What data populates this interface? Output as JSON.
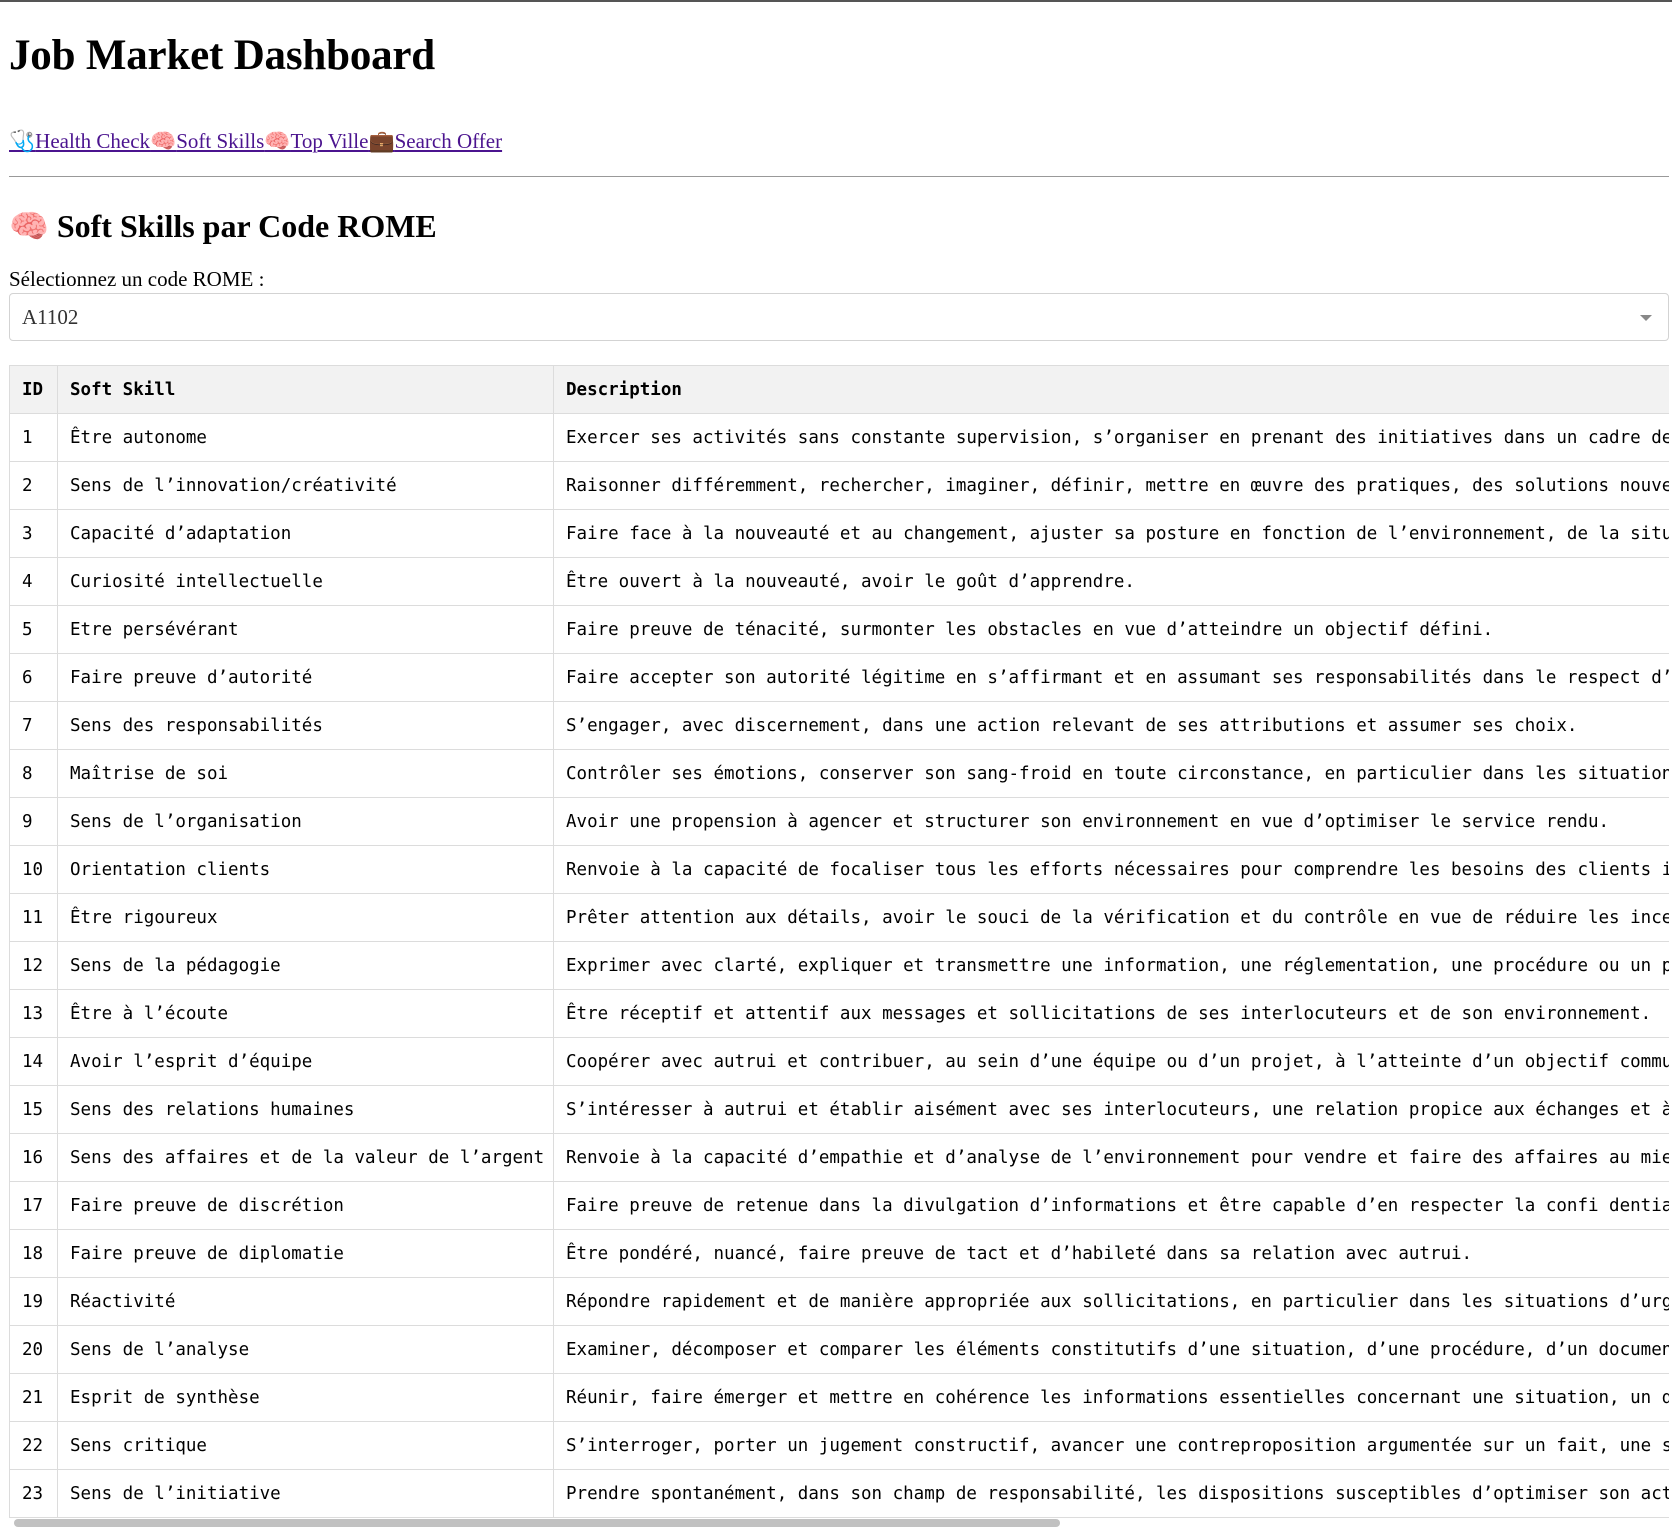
{
  "header": {
    "title": "Job Market Dashboard"
  },
  "nav": {
    "links": [
      {
        "icon": "🩺",
        "label": "Health Check"
      },
      {
        "icon": "🧠",
        "label": "Soft Skills"
      },
      {
        "icon": "🧠",
        "label": "Top Ville"
      },
      {
        "icon": "💼",
        "label": "Search Offer"
      }
    ]
  },
  "section": {
    "icon": "🧠",
    "title": "Soft Skills par Code ROME",
    "select_label": "Sélectionnez un code ROME :",
    "select_value": "A1102"
  },
  "table": {
    "headers": [
      "ID",
      "Soft Skill",
      "Description"
    ],
    "rows": [
      [
        "1",
        "Être autonome",
        "Exercer ses activités sans constante supervision, s’organiser en prenant des initiatives dans un cadre de"
      ],
      [
        "2",
        "Sens de l’innovation/créativité",
        "Raisonner différemment, rechercher, imaginer, définir, mettre en œuvre des pratiques, des solutions nouvel"
      ],
      [
        "3",
        "Capacité d’adaptation",
        "Faire face à la nouveauté et au changement, ajuster sa posture en fonction de l’environnement, de la situa"
      ],
      [
        "4",
        "Curiosité intellectuelle",
        "Être ouvert à la nouveauté, avoir le goût d’apprendre."
      ],
      [
        "5",
        "Etre persévérant",
        "Faire preuve de ténacité, surmonter les obstacles en vue d’atteindre un objectif défini."
      ],
      [
        "6",
        "Faire preuve d’autorité",
        "Faire accepter son autorité légitime en s’affirmant et en assumant ses responsabilités dans le respect d’a"
      ],
      [
        "7",
        "Sens des responsabilités",
        "S’engager, avec discernement, dans une action relevant de ses attributions et assumer ses choix."
      ],
      [
        "8",
        "Maîtrise de soi",
        "Contrôler ses émotions, conserver son sang-froid en toute circonstance, en particulier dans les situations"
      ],
      [
        "9",
        "Sens de l’organisation",
        "Avoir une propension à agencer et structurer son environnement en vue d’optimiser le service rendu."
      ],
      [
        "10",
        "Orientation clients",
        "Renvoie à la capacité de focaliser tous les efforts nécessaires pour comprendre les besoins des clients in"
      ],
      [
        "11",
        "Être rigoureux",
        "Prêter attention aux détails, avoir le souci de la vérification et du contrôle en vue de réduire les ince"
      ],
      [
        "12",
        "Sens de la pédagogie",
        "Exprimer avec clarté, expliquer et transmettre une information, une réglementation, une procédure ou un pr"
      ],
      [
        "13",
        "Être à l’écoute",
        "Être réceptif et attentif aux messages et sollicitations de ses interlocuteurs et de son environnement."
      ],
      [
        "14",
        "Avoir l’esprit d’équipe",
        "Coopérer avec autrui et contribuer, au sein d’une équipe ou d’un projet, à l’atteinte d’un objectif commun"
      ],
      [
        "15",
        "Sens des relations humaines",
        "S’intéresser à autrui et établir aisément avec ses interlocuteurs, une relation propice aux échanges et à"
      ],
      [
        "16",
        "Sens des affaires et de la valeur de l’argent",
        "Renvoie à la capacité d’empathie et d’analyse de l’environnement pour vendre et faire des affaires au mieu"
      ],
      [
        "17",
        "Faire preuve de discrétion",
        "Faire preuve de retenue dans la divulgation d’informations et être capable d’en respecter la confi dentia"
      ],
      [
        "18",
        "Faire preuve de diplomatie",
        "Être pondéré, nuancé, faire preuve de tact et d’habileté dans sa relation avec autrui."
      ],
      [
        "19",
        "Réactivité",
        "Répondre rapidement et de manière appropriée aux sollicitations, en particulier dans les situations d’urge"
      ],
      [
        "20",
        "Sens de l’analyse",
        "Examiner, décomposer et comparer les éléments constitutifs d’une situation, d’une procédure, d’un documen"
      ],
      [
        "21",
        "Esprit de synthèse",
        "Réunir, faire émerger et mettre en cohérence les informations essentielles concernant une situation, un do"
      ],
      [
        "22",
        "Sens critique",
        "S’interroger, porter un jugement constructif, avancer une contreproposition argumentée sur un fait, une si"
      ],
      [
        "23",
        "Sens de l’initiative",
        "Prendre spontanément, dans son champ de responsabilité, les dispositions susceptibles d’optimiser son acti"
      ]
    ]
  }
}
